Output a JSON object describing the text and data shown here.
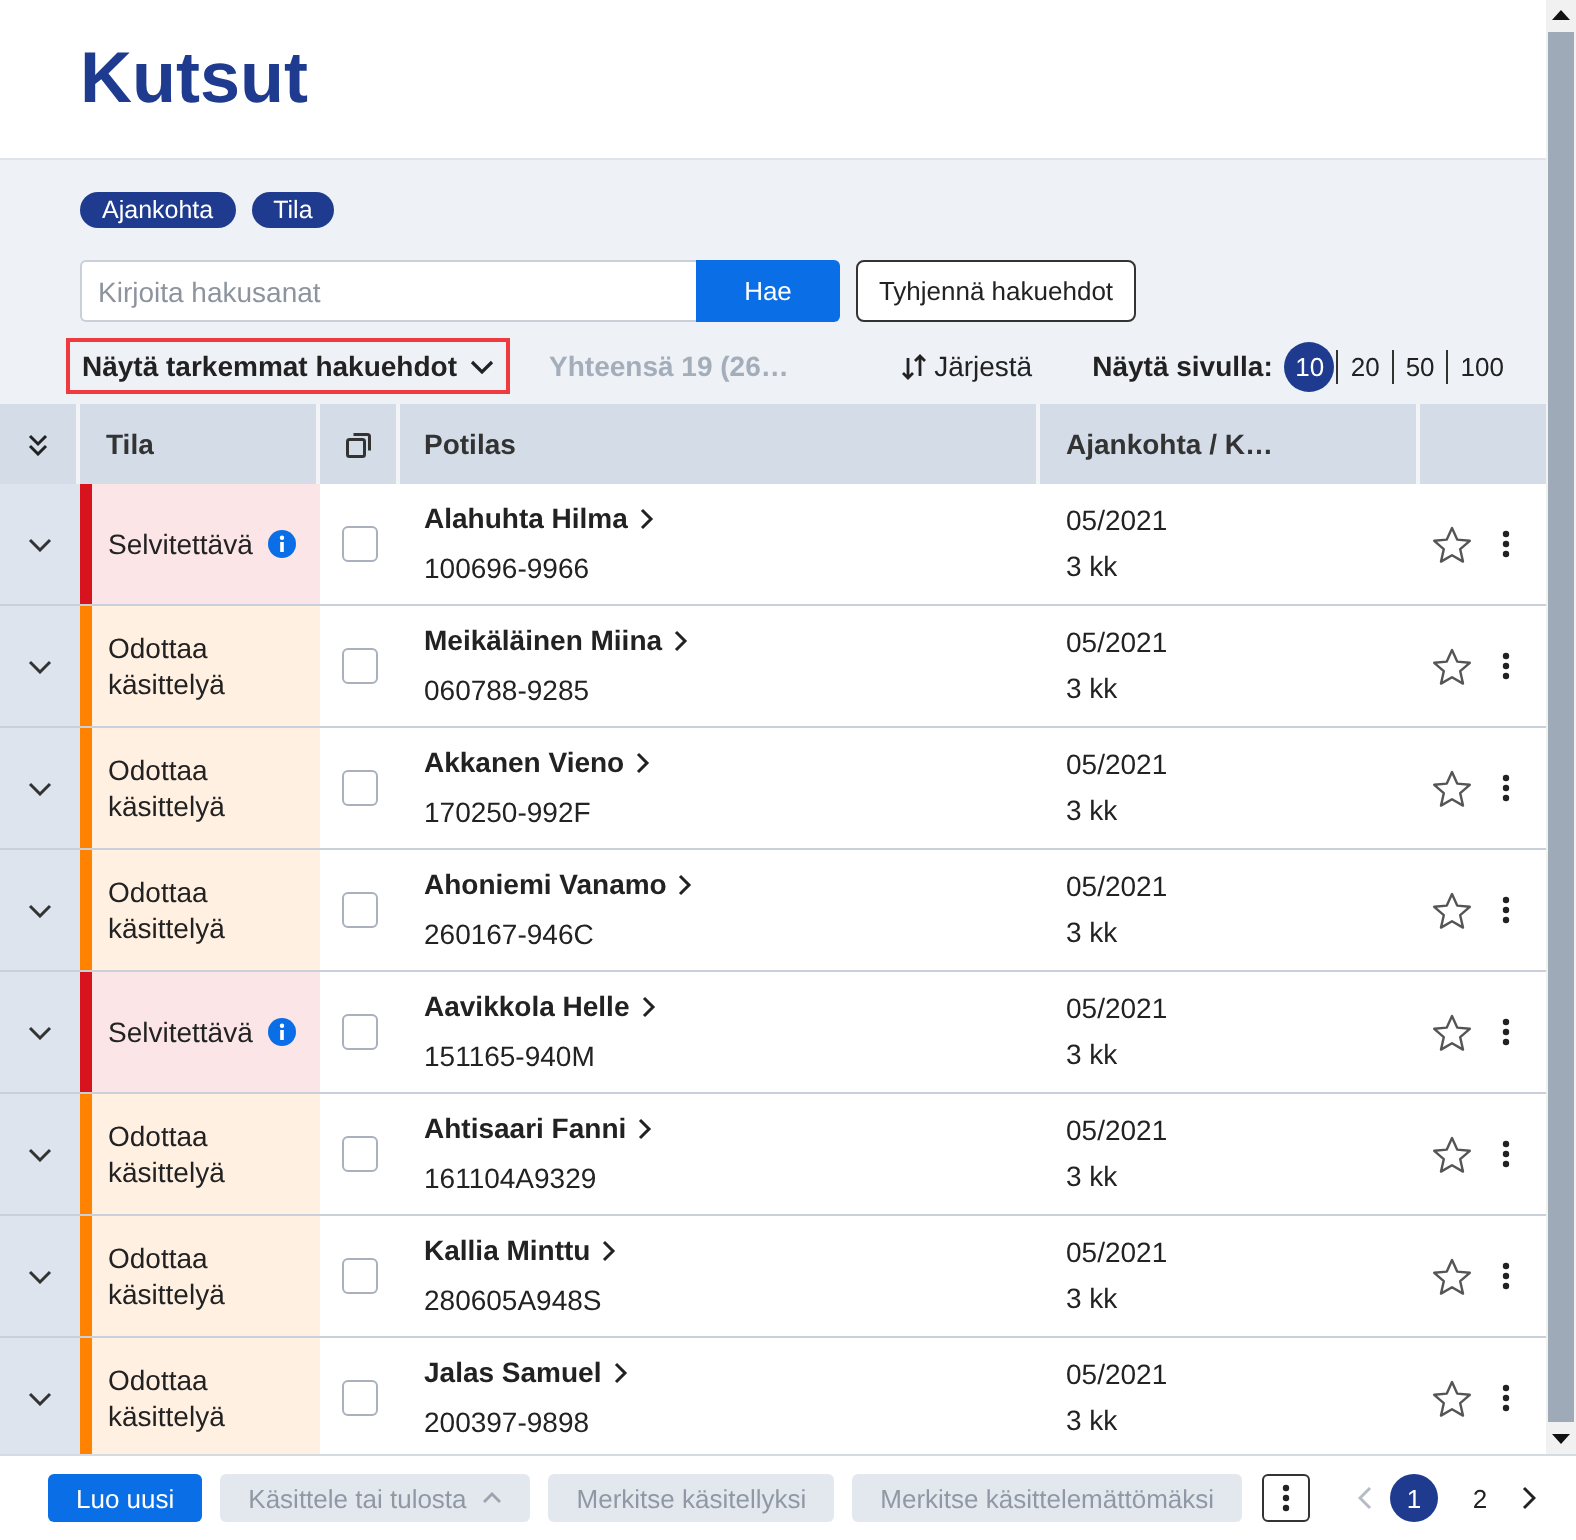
{
  "title": "Kutsut",
  "filter_chips": [
    {
      "label": "Ajankohta"
    },
    {
      "label": "Tila"
    }
  ],
  "search": {
    "placeholder": "Kirjoita hakusanat",
    "submit": "Hae",
    "clear": "Tyhjennä hakuehdot"
  },
  "toolbar": {
    "more_filters": {
      "label": "Näytä tarkemmat hakuehdot",
      "highlighted": true
    },
    "total": "Yhteensä 19 (26…",
    "sort": "Järjestä",
    "page_size_label": "Näytä sivulla:",
    "page_sizes": [
      {
        "label": "10",
        "selected": true
      },
      {
        "label": "20",
        "selected": false
      },
      {
        "label": "50",
        "selected": false
      },
      {
        "label": "100",
        "selected": false
      }
    ]
  },
  "table": {
    "columns": [
      {
        "label": "Tila"
      },
      {
        "label": "Potilas"
      },
      {
        "label": "Ajankohta / K…"
      }
    ],
    "rows": [
      {
        "expanded": false,
        "status": {
          "kind": "unresolved",
          "label": "Selvitettävä"
        },
        "checked": false,
        "name": "Alahuhta Hilma",
        "id": "100696-9966",
        "date": "05/2021",
        "duration": "3 kk",
        "starred": false
      },
      {
        "expanded": false,
        "status": {
          "kind": "pending",
          "label": "Odottaa käsittelyä"
        },
        "checked": false,
        "name": "Meikäläinen Miina",
        "id": "060788-9285",
        "date": "05/2021",
        "duration": "3 kk",
        "starred": false
      },
      {
        "expanded": false,
        "status": {
          "kind": "pending",
          "label": "Odottaa käsittelyä"
        },
        "checked": false,
        "name": "Akkanen Vieno",
        "id": "170250-992F",
        "date": "05/2021",
        "duration": "3 kk",
        "starred": false
      },
      {
        "expanded": false,
        "status": {
          "kind": "pending",
          "label": "Odottaa käsittelyä"
        },
        "checked": false,
        "name": "Ahoniemi Vanamo",
        "id": "260167-946C",
        "date": "05/2021",
        "duration": "3 kk",
        "starred": false
      },
      {
        "expanded": false,
        "status": {
          "kind": "unresolved",
          "label": "Selvitettävä"
        },
        "checked": false,
        "name": "Aavikkola Helle",
        "id": "151165-940M",
        "date": "05/2021",
        "duration": "3 kk",
        "starred": false
      },
      {
        "expanded": false,
        "status": {
          "kind": "pending",
          "label": "Odottaa käsittelyä"
        },
        "checked": false,
        "name": "Ahtisaari Fanni",
        "id": "161104A9329",
        "date": "05/2021",
        "duration": "3 kk",
        "starred": false
      },
      {
        "expanded": false,
        "status": {
          "kind": "pending",
          "label": "Odottaa käsittelyä"
        },
        "checked": false,
        "name": "Kallia Minttu",
        "id": "280605A948S",
        "date": "05/2021",
        "duration": "3 kk",
        "starred": false
      },
      {
        "expanded": false,
        "status": {
          "kind": "pending",
          "label": "Odottaa käsittelyä"
        },
        "checked": false,
        "name": "Jalas Samuel",
        "id": "200397-9898",
        "date": "05/2021",
        "duration": "3 kk",
        "starred": false
      }
    ]
  },
  "footer": {
    "buttons": [
      {
        "label": "Luo uusi",
        "kind": "primary",
        "disabled": false
      },
      {
        "label": "Käsittele tai tulosta",
        "kind": "dropdown",
        "disabled": true
      },
      {
        "label": "Merkitse käsitellyksi",
        "kind": "secondary",
        "disabled": true
      },
      {
        "label": "Merkitse käsittelemättömäksi",
        "kind": "secondary",
        "disabled": true
      }
    ],
    "pagination": {
      "prev_disabled": true,
      "next_disabled": false,
      "pages": [
        {
          "label": "1",
          "selected": true
        },
        {
          "label": "2",
          "selected": false
        }
      ]
    }
  }
}
